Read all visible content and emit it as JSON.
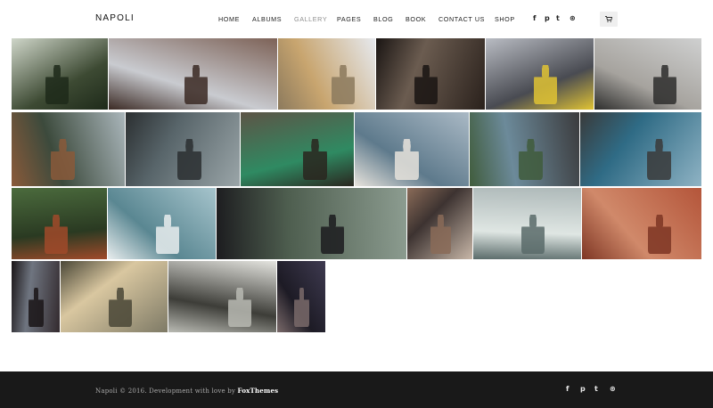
{
  "site": {
    "logo": "NAPOLI"
  },
  "nav": {
    "items": [
      {
        "label": "HOME"
      },
      {
        "label": "ALBUMS"
      },
      {
        "label": "GALLERY"
      },
      {
        "label": "PAGES"
      },
      {
        "label": "BLOG"
      },
      {
        "label": "BOOK"
      },
      {
        "label": "CONTACT US"
      },
      {
        "label": "SHOP"
      }
    ],
    "active": "GALLERY"
  },
  "social": {
    "glyphs": {
      "facebook": "f",
      "pinterest": "p",
      "twitter": "t",
      "dribbble": "⊛"
    }
  },
  "cart": {
    "icon": "cart-icon"
  },
  "gallery": {
    "photos": [
      {
        "name": "greenhouse-sign",
        "colors": [
          "#cfd6c9",
          "#3d4a33",
          "#1e2a1a"
        ]
      },
      {
        "name": "woman-blowing-hair",
        "colors": [
          "#7d6257",
          "#c9cbd0",
          "#3b2a24"
        ]
      },
      {
        "name": "two-girls-field",
        "colors": [
          "#e6e9ee",
          "#c8a56f",
          "#8c7a5d"
        ]
      },
      {
        "name": "woman-sitting-room",
        "colors": [
          "#2a211c",
          "#6b5c50",
          "#1a1513"
        ]
      },
      {
        "name": "bridge-yellow-jacket",
        "colors": [
          "#b9bcc3",
          "#494b52",
          "#e0c334"
        ]
      },
      {
        "name": "woman-lying-window",
        "colors": [
          "#cfd0d0",
          "#a6a39e",
          "#2e2e2d"
        ]
      },
      {
        "name": "lake-forest-redhead",
        "colors": [
          "#aab6bb",
          "#3c4a3c",
          "#8a5a3a"
        ]
      },
      {
        "name": "sea-mist-sitting",
        "colors": [
          "#9aa5a8",
          "#58656a",
          "#2b2f31"
        ]
      },
      {
        "name": "bench-green-railing",
        "colors": [
          "#5d5446",
          "#2f8a62",
          "#2a261f"
        ]
      },
      {
        "name": "woman-arms-up-beach",
        "colors": [
          "#aab9c5",
          "#5e7a8c",
          "#e7e3dc"
        ]
      },
      {
        "name": "hands-holding-plant",
        "colors": [
          "#3b3b3d",
          "#6c8a9a",
          "#405c3c"
        ]
      },
      {
        "name": "woman-rocks-sea",
        "colors": [
          "#8fb3c4",
          "#2f6b85",
          "#3a3a3a"
        ]
      },
      {
        "name": "redhead-bushes",
        "colors": [
          "#4b6b3d",
          "#2a3a22",
          "#a04a2a"
        ]
      },
      {
        "name": "white-dress-lake",
        "colors": [
          "#a6c4cc",
          "#5a8792",
          "#e8edee"
        ]
      },
      {
        "name": "black-hat-forest",
        "colors": [
          "#8c9c90",
          "#4e5e4f",
          "#1c1c1f"
        ]
      },
      {
        "name": "hair-wind-sunset",
        "colors": [
          "#c7b6a7",
          "#3d3331",
          "#8a6b58"
        ]
      },
      {
        "name": "girl-car-window",
        "colors": [
          "#aeb9b9",
          "#dfe6e3",
          "#5a6b6a"
        ]
      },
      {
        "name": "red-canyon",
        "colors": [
          "#b4553a",
          "#d0896a",
          "#7e3624"
        ]
      },
      {
        "name": "woman-dark-building",
        "colors": [
          "#332a2e",
          "#6f7580",
          "#1a1517"
        ]
      },
      {
        "name": "blonde-hair-blowing",
        "colors": [
          "#7e7a66",
          "#d9c7a0",
          "#4a4737"
        ]
      },
      {
        "name": "man-white-flowers",
        "colors": [
          "#e4e4df",
          "#3d3d38",
          "#b9bab3"
        ]
      },
      {
        "name": "woman-shadow-wall",
        "colors": [
          "#3e3a50",
          "#1d1b25",
          "#7a6a6a"
        ]
      }
    ]
  },
  "footer": {
    "copyright": "Napoli © 2016. Development with love by",
    "brand": "FoxThemes"
  }
}
